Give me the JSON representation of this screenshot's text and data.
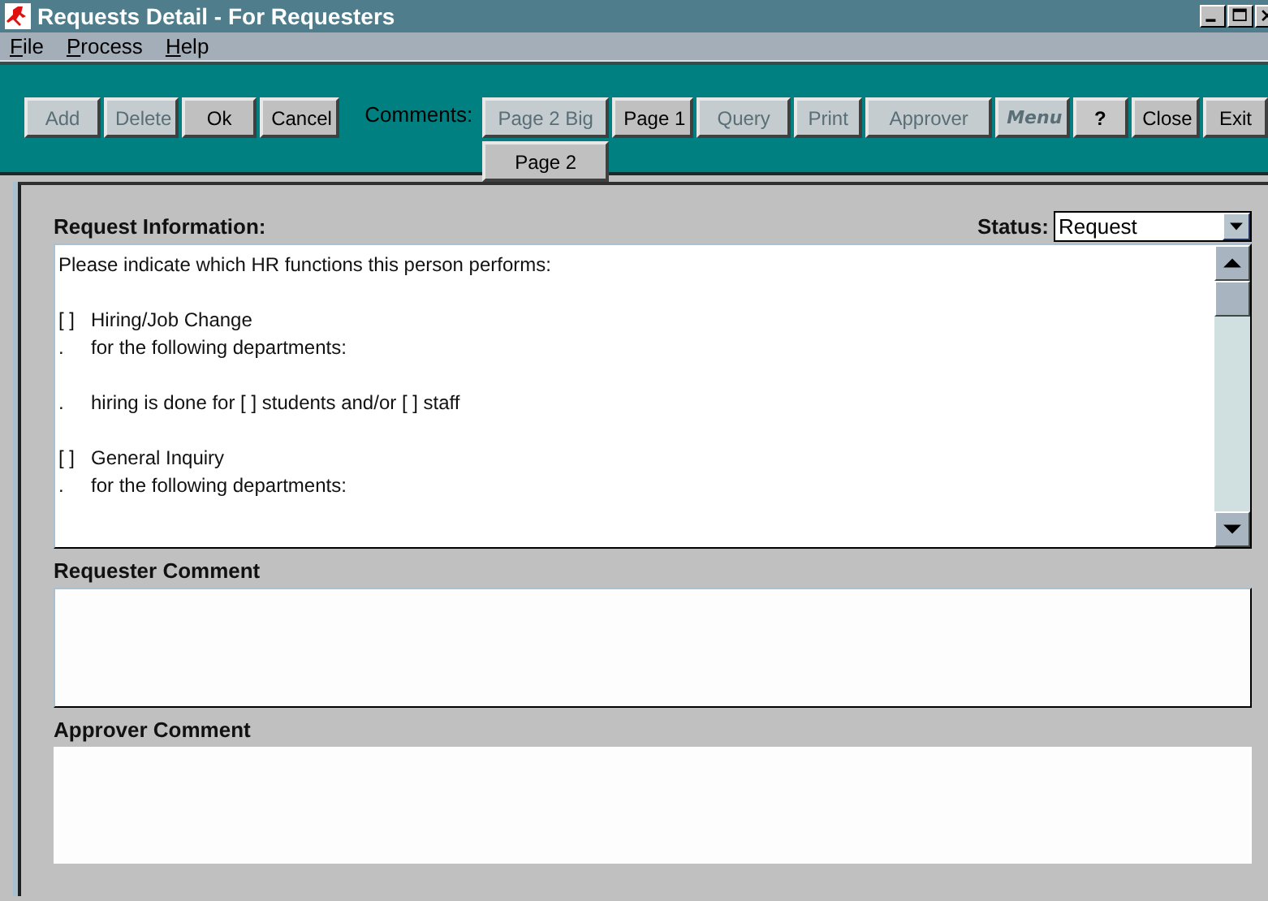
{
  "window": {
    "title": "Requests Detail - For Requesters"
  },
  "menu": [
    {
      "label": "File"
    },
    {
      "label": "Process"
    },
    {
      "label": "Help"
    }
  ],
  "toolbar": {
    "buttons_left": [
      {
        "label": "Add",
        "disabled": true
      },
      {
        "label": "Delete",
        "disabled": true
      },
      {
        "label": "Ok",
        "disabled": false
      },
      {
        "label": "Cancel",
        "disabled": false
      }
    ],
    "comments_label": "Comments:",
    "comment_pages": [
      {
        "label": "Page 2 Big",
        "disabled": true
      },
      {
        "label": "Page 2",
        "disabled": false
      }
    ],
    "buttons_right": [
      {
        "label": "Page 1",
        "disabled": false,
        "kind": "plain"
      },
      {
        "label": "Query",
        "disabled": true,
        "kind": "plain"
      },
      {
        "label": "Print",
        "disabled": true,
        "kind": "plain"
      },
      {
        "label": "Approver",
        "disabled": true,
        "kind": "plain"
      },
      {
        "label": "Menu",
        "disabled": true,
        "kind": "italic"
      },
      {
        "label": "?",
        "disabled": false,
        "kind": "help"
      },
      {
        "label": "Close",
        "disabled": false,
        "kind": "plain"
      },
      {
        "label": "Exit",
        "disabled": false,
        "kind": "plain"
      }
    ]
  },
  "request_information": {
    "label": "Request Information:",
    "status_label": "Status:",
    "status_value": "Request",
    "blocks": [
      [
        {
          "text": "Please indicate which HR functions this person performs:"
        }
      ],
      [
        {
          "marker": "[ ]",
          "text": "Hiring/Job Change"
        },
        {
          "marker": ".",
          "text": "for the following departments:"
        }
      ],
      [
        {
          "marker": ".",
          "text": "hiring is done for [  ] students and/or [  ] staff"
        }
      ],
      [
        {
          "marker": "[ ]",
          "text": "General Inquiry"
        },
        {
          "marker": ".",
          "text": "for the following departments:"
        }
      ]
    ]
  },
  "requester_comment": {
    "label": "Requester Comment"
  },
  "approver_comment": {
    "label": "Approver Comment"
  }
}
